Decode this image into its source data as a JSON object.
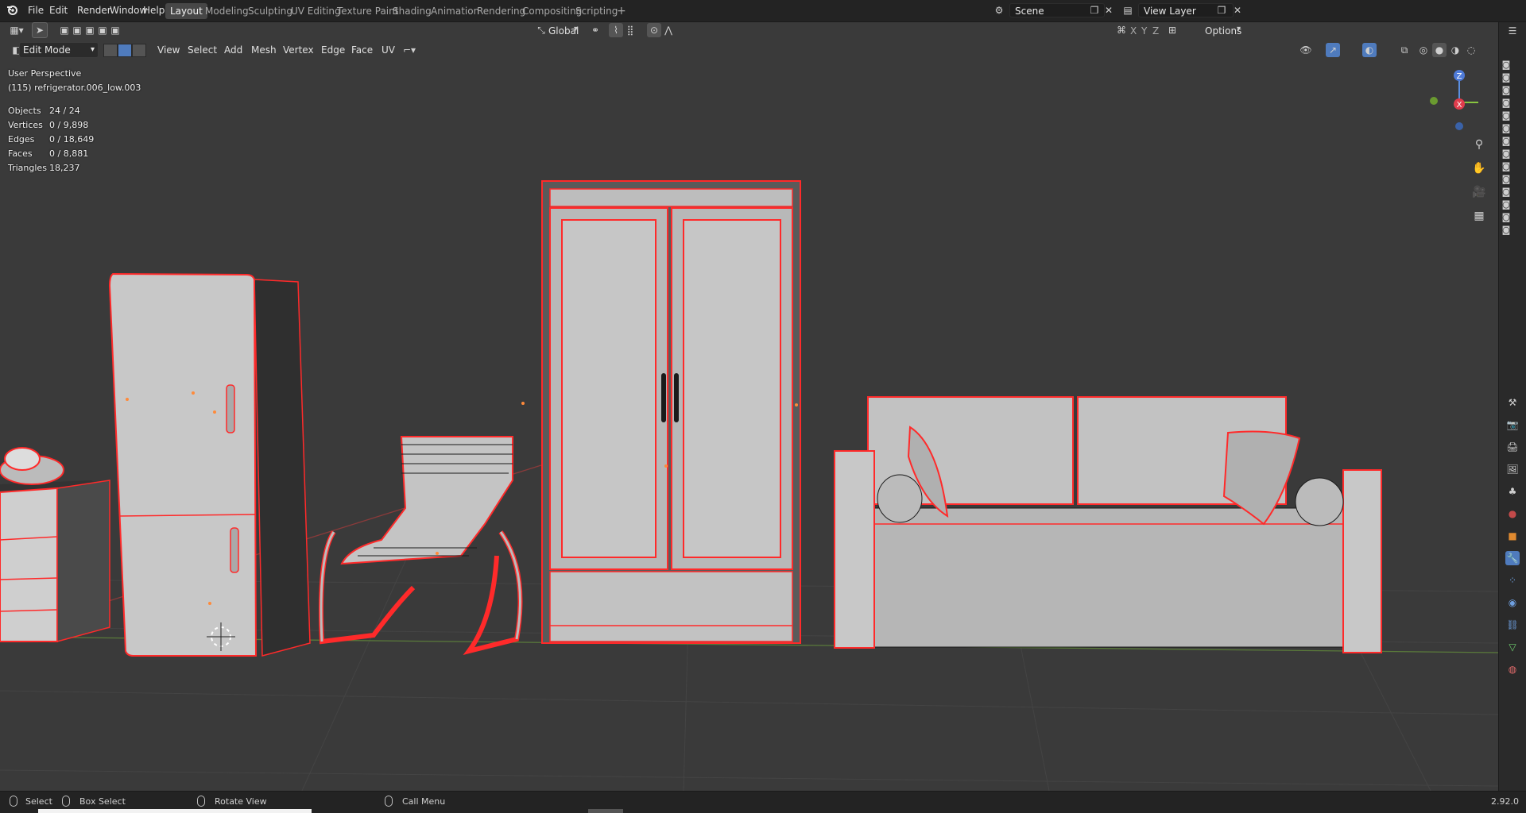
{
  "menu": [
    "File",
    "Edit",
    "Render",
    "Window",
    "Help"
  ],
  "workspaces": [
    "Layout",
    "Modeling",
    "Sculpting",
    "UV Editing",
    "Texture Paint",
    "Shading",
    "Animation",
    "Rendering",
    "Compositing",
    "Scripting"
  ],
  "active_workspace": "Layout",
  "scene": {
    "label": "Scene"
  },
  "view_layer": {
    "label": "View Layer"
  },
  "header": {
    "transform_orientation": "Global",
    "options": "Options",
    "axes": [
      "X",
      "Y",
      "Z"
    ]
  },
  "edit_header": {
    "mode": "Edit Mode",
    "menus": [
      "View",
      "Select",
      "Add",
      "Mesh",
      "Vertex",
      "Edge",
      "Face",
      "UV"
    ]
  },
  "overlay": {
    "view_name": "User Perspective",
    "object_name": "(115) refrigerator.006_low.003",
    "stats": [
      {
        "label": "Objects",
        "value": "24 / 24"
      },
      {
        "label": "Vertices",
        "value": "0 / 9,898"
      },
      {
        "label": "Edges",
        "value": "0 / 18,649"
      },
      {
        "label": "Faces",
        "value": "0 / 8,881"
      },
      {
        "label": "Triangles",
        "value": "18,237"
      }
    ]
  },
  "gizmo": {
    "x": "X",
    "y": "Y",
    "z": "Z"
  },
  "status": {
    "select": "Select",
    "box_select": "Box Select",
    "rotate": "Rotate View",
    "call_menu": "Call Menu",
    "version": "2.92.0"
  },
  "colors": {
    "accent": "#4f7bbd",
    "wire": "#ff3030",
    "bg": "#3a3a3a"
  }
}
